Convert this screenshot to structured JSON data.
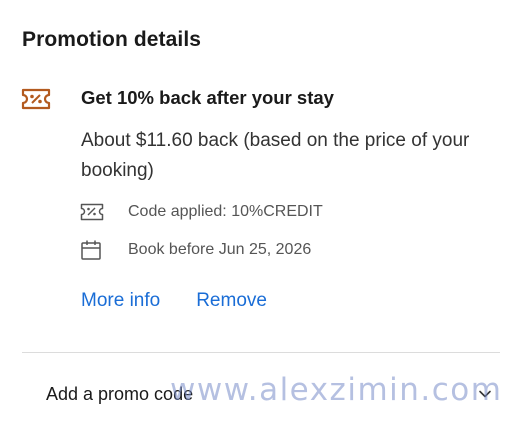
{
  "panel": {
    "title": "Promotion details"
  },
  "promotion": {
    "icon": "coupon-icon",
    "heading": "Get 10% back after your stay",
    "description": "About $11.60 back (based on the price of your booking)",
    "code_applied": "Code applied: 10%CREDIT",
    "book_before": "Book before Jun 25, 2026",
    "more_info_label": "More info",
    "remove_label": "Remove"
  },
  "promo_code": {
    "label": "Add a promo code",
    "icon": "chevron-down-icon"
  },
  "watermark": {
    "text": "www.alexzimin.com"
  },
  "colors": {
    "accent": "#1a6dd6",
    "coupon_icon": "#b35a1f",
    "text_primary": "#1a1a1a",
    "text_secondary": "#555555",
    "divider": "#dcdcdc"
  }
}
